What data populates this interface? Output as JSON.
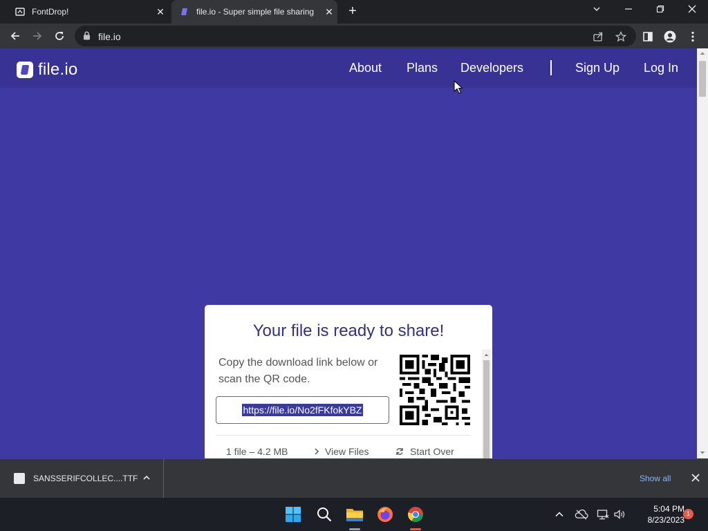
{
  "browser": {
    "tabs": [
      {
        "title": "FontDrop!",
        "active": false
      },
      {
        "title": "file.io - Super simple file sharing",
        "active": true
      }
    ],
    "url": "file.io"
  },
  "site": {
    "logo_text": "file.io",
    "nav": [
      "About",
      "Plans",
      "Developers",
      "Sign Up",
      "Log In"
    ]
  },
  "share_card": {
    "heading": "Your file is ready to share!",
    "description": "Copy the download link below or scan the QR code.",
    "link": "https://file.io/No2fFKfokYBZ",
    "file_info": "1 file – 4.2 MB",
    "view_files": "View Files",
    "start_over": "Start Over"
  },
  "downloads": {
    "filename": "SANSSERIFCOLLEC....TTF",
    "show_all": "Show all"
  },
  "taskbar": {
    "time": "5:04 PM",
    "date": "8/23/2023",
    "notification_count": "1"
  },
  "colors": {
    "page_bg": "#3f3aa3",
    "header_bg": "#383294",
    "heading": "#36307f",
    "link_selection": "#3a3a9a"
  }
}
